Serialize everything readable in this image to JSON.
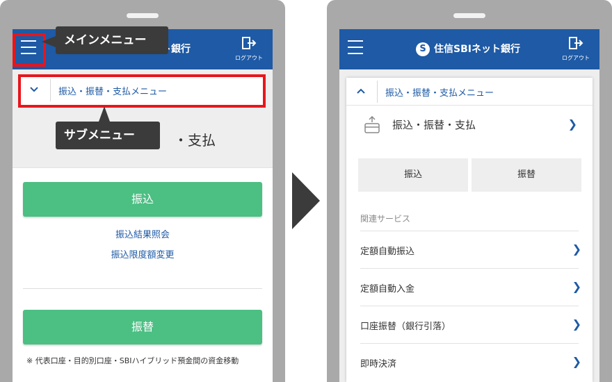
{
  "left_phone": {
    "header": {
      "brand_partial": "ト銀行",
      "logout_label": "ログアウト"
    },
    "subnav": {
      "label": "振込・振替・支払メニュー"
    },
    "callouts": {
      "main_menu": "メインメニュー",
      "sub_menu": "サブメニュー"
    },
    "page_title_fragment": "・支払",
    "buttons": {
      "transfer": "振込",
      "account_transfer": "振替"
    },
    "links": {
      "transfer_results": "振込結果照会",
      "transfer_limit": "振込限度額変更"
    },
    "note": "※ 代表口座・目的別口座・SBIハイブリッド預金間の資金移動"
  },
  "right_phone": {
    "header": {
      "brand": "住信SBIネット銀行",
      "logout_label": "ログアウト"
    },
    "menu": {
      "collapse_label": "振込・振替・支払メニュー",
      "category_title": "振込・振替・支払",
      "buttons": [
        "振込",
        "振替"
      ],
      "related_label": "関連サービス",
      "related_items": [
        "定額自動振込",
        "定額自動入金",
        "口座振替（銀行引落）",
        "即時決済"
      ]
    }
  },
  "colors": {
    "brand_blue": "#1e5aa5",
    "green": "#4cbf83",
    "highlight_red": "#e8151c",
    "callout_bg": "#3b3b3b"
  },
  "icons": [
    "hamburger-icon",
    "logout-icon",
    "chevron-down-icon",
    "chevron-up-icon",
    "chevron-right-icon",
    "payment-card-icon",
    "bank-logo-icon"
  ]
}
